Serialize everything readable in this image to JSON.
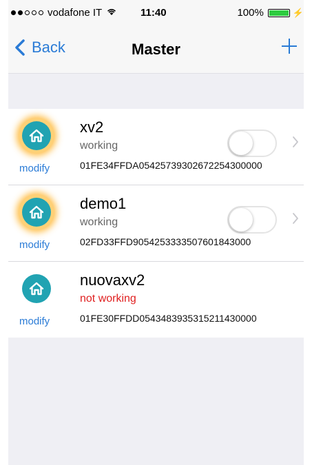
{
  "status_bar": {
    "carrier": "vodafone IT",
    "time": "11:40",
    "battery": "100%",
    "battery_level": 1.0,
    "signal_dots": [
      true,
      true,
      false,
      false,
      false
    ]
  },
  "nav": {
    "back_label": "Back",
    "title": "Master",
    "add_icon": "plus-icon"
  },
  "colors": {
    "accent": "#2a7bd6",
    "icon_teal": "#21a3b2",
    "error": "#e02020"
  },
  "devices": [
    {
      "name": "xv2",
      "status": "working",
      "code": "01FE34FFDA05425739302672254300000",
      "glow": true,
      "toggle_on": false,
      "has_toggle": true
    },
    {
      "name": "demo1",
      "status": "working",
      "code": "02FD33FFD9054253333507601843000",
      "glow": true,
      "toggle_on": false,
      "has_toggle": true
    },
    {
      "name": "nuovaxv2",
      "status": "not working",
      "code": "01FE30FFDD0543483935315211430000",
      "glow": false,
      "toggle_on": false,
      "has_toggle": false
    }
  ],
  "modify_label": "modify"
}
